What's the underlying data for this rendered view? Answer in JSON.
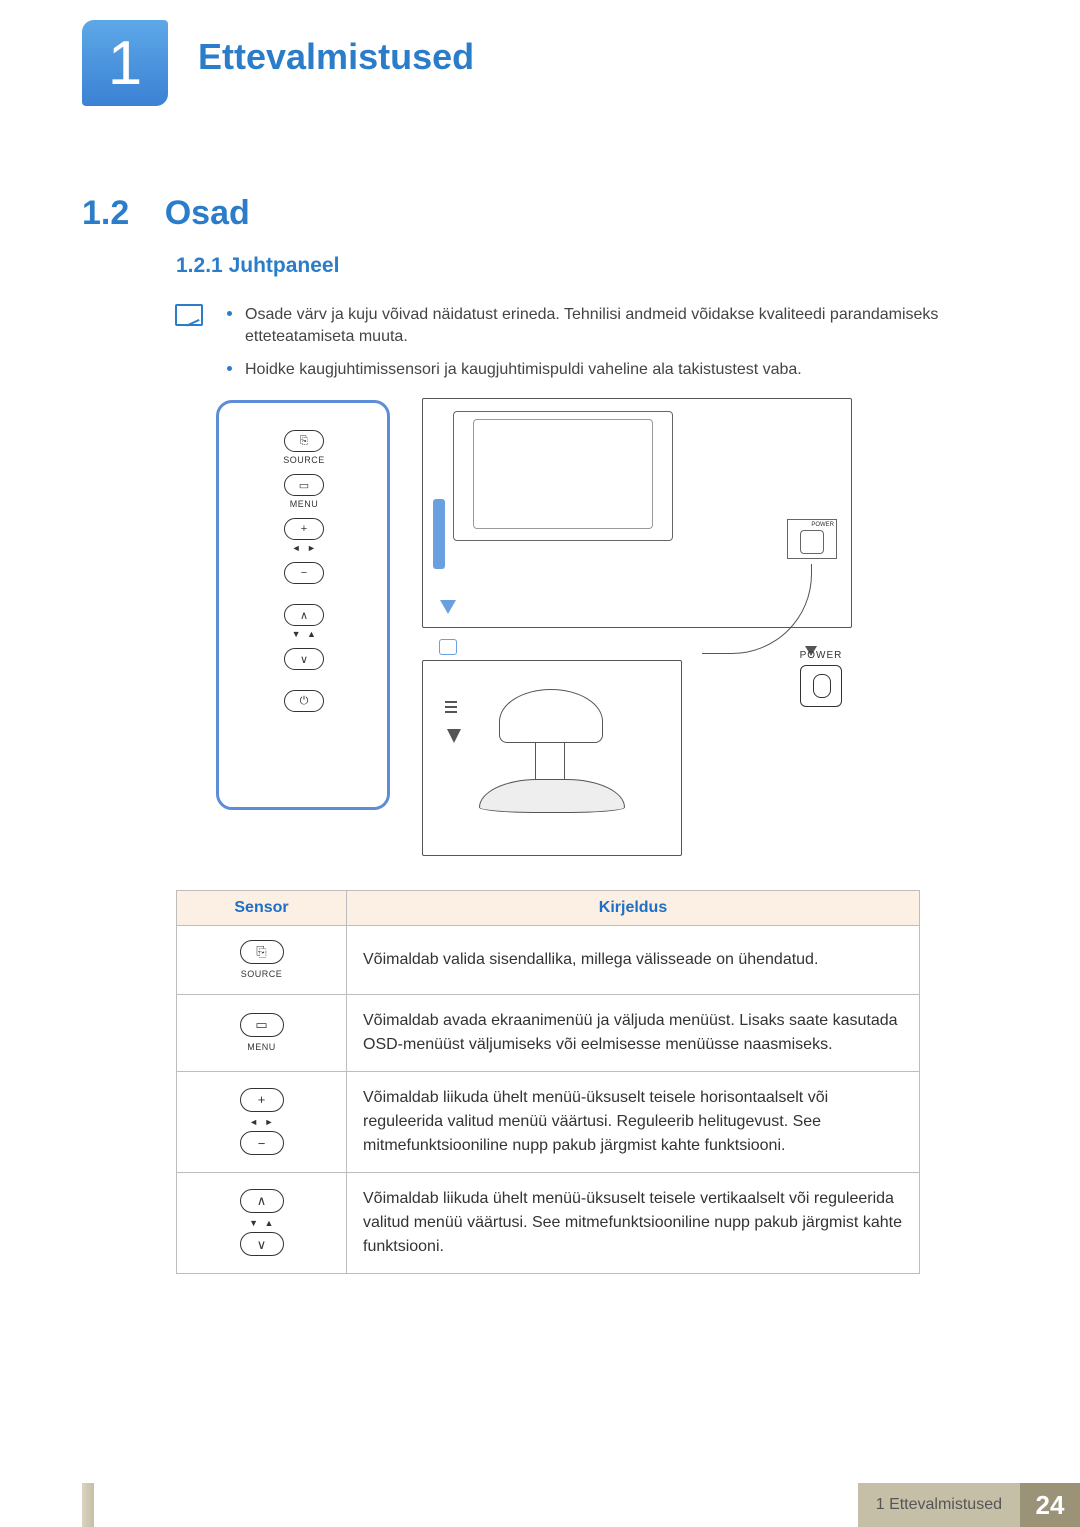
{
  "chapter": {
    "number": "1",
    "title": "Ettevalmistused"
  },
  "section": {
    "number": "1.2",
    "title": "Osad"
  },
  "subsection": {
    "number": "1.2.1",
    "title": "Juhtpaneel"
  },
  "notes": [
    "Osade värv ja kuju võivad näidatust erineda. Tehnilisi andmeid võidakse kvaliteedi parandamiseks etteteatamiseta muuta.",
    "Hoidke kaugjuhtimissensori ja kaugjuhtimispuldi vaheline ala takistustest vaba."
  ],
  "panel_labels": {
    "source": "SOURCE",
    "menu": "MENU",
    "power": "POWER"
  },
  "table": {
    "headers": {
      "sensor": "Sensor",
      "desc": "Kirjeldus"
    },
    "rows": [
      {
        "sensor_label": "SOURCE",
        "desc": "Võimaldab valida sisendallika, millega välisseade on ühendatud."
      },
      {
        "sensor_label": "MENU",
        "desc": "Võimaldab avada ekraanimenüü ja väljuda menüüst. Lisaks saate kasutada OSD-menüüst väljumiseks või eelmisesse menüüsse naasmiseks."
      },
      {
        "sensor_label": "",
        "desc": "Võimaldab liikuda ühelt menüü-üksuselt teisele horisontaalselt või reguleerida valitud menüü väärtusi. Reguleerib helitugevust. See mitmefunktsiooniline nupp pakub järgmist kahte funktsiooni."
      },
      {
        "sensor_label": "",
        "desc": "Võimaldab liikuda ühelt menüü-üksuselt teisele vertikaalselt või reguleerida valitud menüü väärtusi. See mitmefunktsiooniline nupp pakub järgmist kahte funktsiooni."
      }
    ]
  },
  "footer": {
    "chapter_text": "1 Ettevalmistused",
    "page": "24"
  }
}
